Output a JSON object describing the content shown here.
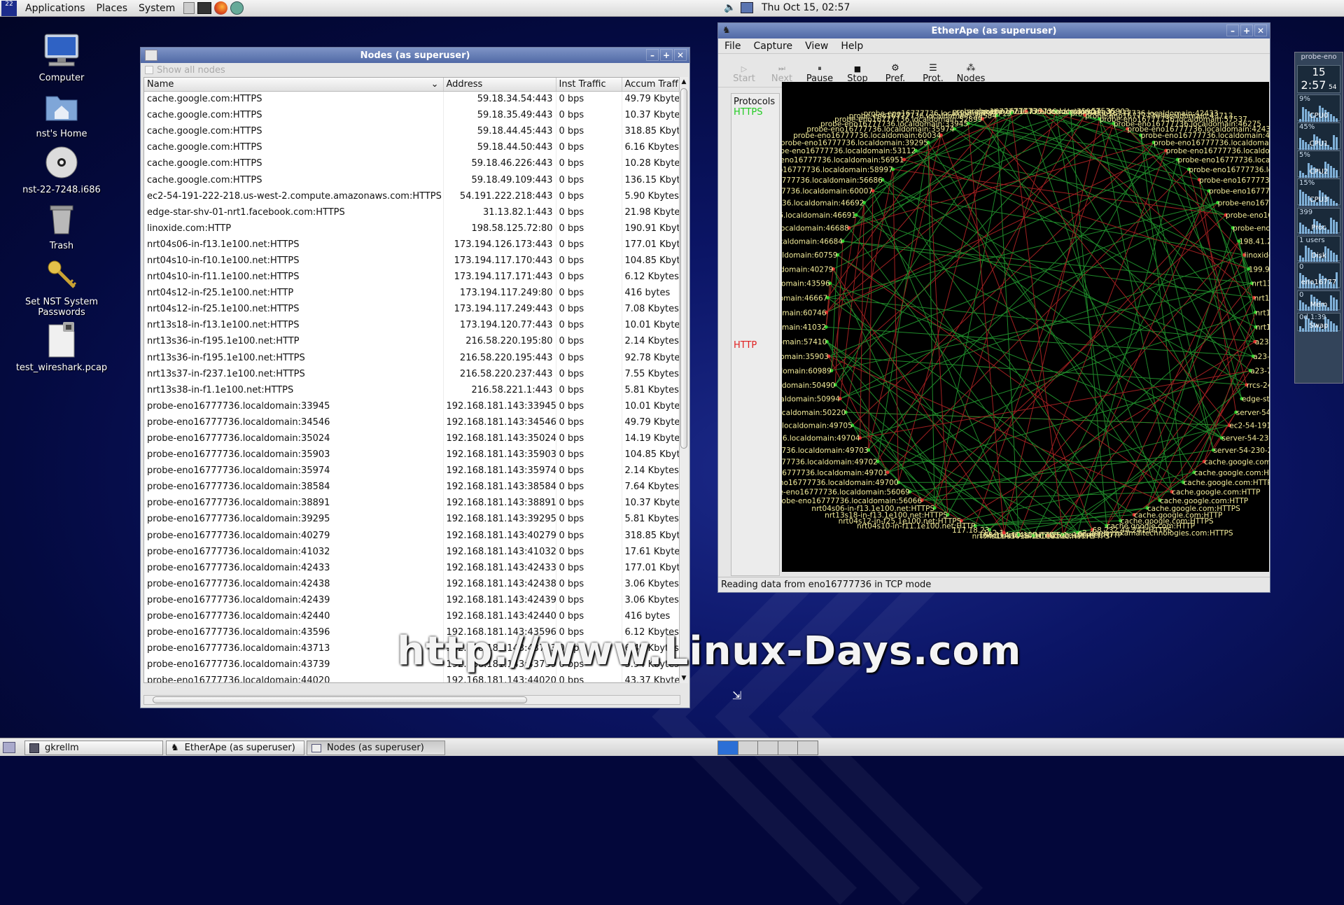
{
  "topbar": {
    "menu": [
      "Applications",
      "Places",
      "System"
    ],
    "clock": "Thu Oct 15, 02:57"
  },
  "desktop_icons": [
    {
      "label": "Computer",
      "icon": "computer-icon"
    },
    {
      "label": "nst's Home",
      "icon": "home-folder-icon"
    },
    {
      "label": "nst-22-7248.i686",
      "icon": "cd-icon"
    },
    {
      "label": "Trash",
      "icon": "trash-icon"
    },
    {
      "label": "Set NST System Passwords",
      "icon": "keys-icon"
    },
    {
      "label": "test_wireshark.pcap",
      "icon": "file-icon"
    }
  ],
  "nodes_window": {
    "title": "Nodes (as superuser)",
    "show_all": "Show all nodes",
    "columns": [
      "Name",
      "Address",
      "Inst Traffic",
      "Accum Traff"
    ],
    "rows": [
      [
        "cache.google.com:HTTPS",
        "59.18.34.54:443",
        "0 bps",
        "49.79 Kbyte"
      ],
      [
        "cache.google.com:HTTPS",
        "59.18.35.49:443",
        "0 bps",
        "10.37 Kbyte"
      ],
      [
        "cache.google.com:HTTPS",
        "59.18.44.45:443",
        "0 bps",
        "318.85 Kbyt"
      ],
      [
        "cache.google.com:HTTPS",
        "59.18.44.50:443",
        "0 bps",
        "6.16 Kbytes"
      ],
      [
        "cache.google.com:HTTPS",
        "59.18.46.226:443",
        "0 bps",
        "10.28 Kbyte"
      ],
      [
        "cache.google.com:HTTPS",
        "59.18.49.109:443",
        "0 bps",
        "136.15 Kbyt"
      ],
      [
        "ec2-54-191-222-218.us-west-2.compute.amazonaws.com:HTTPS",
        "54.191.222.218:443",
        "0 bps",
        "5.90 Kbytes"
      ],
      [
        "edge-star-shv-01-nrt1.facebook.com:HTTPS",
        "31.13.82.1:443",
        "0 bps",
        "21.98 Kbyte"
      ],
      [
        "linoxide.com:HTTP",
        "198.58.125.72:80",
        "0 bps",
        "190.91 Kbyt"
      ],
      [
        "nrt04s06-in-f13.1e100.net:HTTPS",
        "173.194.126.173:443",
        "0 bps",
        "177.01 Kbyt"
      ],
      [
        "nrt04s10-in-f10.1e100.net:HTTPS",
        "173.194.117.170:443",
        "0 bps",
        "104.85 Kbyt"
      ],
      [
        "nrt04s10-in-f11.1e100.net:HTTPS",
        "173.194.117.171:443",
        "0 bps",
        "6.12 Kbytes"
      ],
      [
        "nrt04s12-in-f25.1e100.net:HTTP",
        "173.194.117.249:80",
        "0 bps",
        "416 bytes"
      ],
      [
        "nrt04s12-in-f25.1e100.net:HTTPS",
        "173.194.117.249:443",
        "0 bps",
        "7.08 Kbytes"
      ],
      [
        "nrt13s18-in-f13.1e100.net:HTTPS",
        "173.194.120.77:443",
        "0 bps",
        "10.01 Kbyte"
      ],
      [
        "nrt13s36-in-f195.1e100.net:HTTP",
        "216.58.220.195:80",
        "0 bps",
        "2.14 Kbytes"
      ],
      [
        "nrt13s36-in-f195.1e100.net:HTTPS",
        "216.58.220.195:443",
        "0 bps",
        "92.78 Kbyte"
      ],
      [
        "nrt13s37-in-f237.1e100.net:HTTPS",
        "216.58.220.237:443",
        "0 bps",
        "7.55 Kbytes"
      ],
      [
        "nrt13s38-in-f1.1e100.net:HTTPS",
        "216.58.221.1:443",
        "0 bps",
        "5.81 Kbytes"
      ],
      [
        "probe-eno16777736.localdomain:33945",
        "192.168.181.143:33945",
        "0 bps",
        "10.01 Kbyte"
      ],
      [
        "probe-eno16777736.localdomain:34546",
        "192.168.181.143:34546",
        "0 bps",
        "49.79 Kbyte"
      ],
      [
        "probe-eno16777736.localdomain:35024",
        "192.168.181.143:35024",
        "0 bps",
        "14.19 Kbyte"
      ],
      [
        "probe-eno16777736.localdomain:35903",
        "192.168.181.143:35903",
        "0 bps",
        "104.85 Kbyt"
      ],
      [
        "probe-eno16777736.localdomain:35974",
        "192.168.181.143:35974",
        "0 bps",
        "2.14 Kbytes"
      ],
      [
        "probe-eno16777736.localdomain:38584",
        "192.168.181.143:38584",
        "0 bps",
        "7.64 Kbytes"
      ],
      [
        "probe-eno16777736.localdomain:38891",
        "192.168.181.143:38891",
        "0 bps",
        "10.37 Kbyte"
      ],
      [
        "probe-eno16777736.localdomain:39295",
        "192.168.181.143:39295",
        "0 bps",
        "5.81 Kbytes"
      ],
      [
        "probe-eno16777736.localdomain:40279",
        "192.168.181.143:40279",
        "0 bps",
        "318.85 Kbyt"
      ],
      [
        "probe-eno16777736.localdomain:41032",
        "192.168.181.143:41032",
        "0 bps",
        "17.61 Kbyte"
      ],
      [
        "probe-eno16777736.localdomain:42433",
        "192.168.181.143:42433",
        "0 bps",
        "177.01 Kbyt"
      ],
      [
        "probe-eno16777736.localdomain:42438",
        "192.168.181.143:42438",
        "0 bps",
        "3.06 Kbytes"
      ],
      [
        "probe-eno16777736.localdomain:42439",
        "192.168.181.143:42439",
        "0 bps",
        "3.06 Kbytes"
      ],
      [
        "probe-eno16777736.localdomain:42440",
        "192.168.181.143:42440",
        "0 bps",
        "416 bytes"
      ],
      [
        "probe-eno16777736.localdomain:43596",
        "192.168.181.143:43596",
        "0 bps",
        "6.12 Kbytes"
      ],
      [
        "probe-eno16777736.localdomain:43713",
        "192.168.181.143:43713",
        "0 bps",
        "6.49 Kbytes"
      ],
      [
        "probe-eno16777736.localdomain:43739",
        "192.168.181.143:43739",
        "0 bps",
        "5.94 Kbytes"
      ],
      [
        "probe-eno16777736.localdomain:44020",
        "192.168.181.143:44020",
        "0 bps",
        "43.37 Kbyte"
      ]
    ]
  },
  "etherape": {
    "title": "EtherApe (as superuser)",
    "menu": [
      "File",
      "Capture",
      "View",
      "Help"
    ],
    "toolbar": [
      "Start",
      "Next",
      "Pause",
      "Stop",
      "Pref.",
      "Prot.",
      "Nodes"
    ],
    "protocols_label": "Protocols",
    "protocols": [
      {
        "name": "HTTPS",
        "color": "#22cc22"
      },
      {
        "name": "HTTP",
        "color": "#e02020"
      }
    ],
    "status": "Reading data from eno16777736 in TCP mode",
    "graph_nodes": [
      "probe-eno16777736.localdomain:57536",
      "probe-eno16777736.localdomain:35903",
      "probe-eno16777736.localdomain:42433",
      "probe-eno16777736.localdomain:43713",
      "probe-eno16777736.localdomain:57537",
      "probe-eno16777736.localdomain:46275",
      "probe-eno16777736.localdomain:42438",
      "probe-eno16777736.localdomain:42439",
      "probe-eno16777736.localdomain:42440",
      "probe-eno16777736.localdomain:35024",
      "probe-eno16777736.localdomain:43739",
      "probe-eno16777736.localdomain:56803",
      "probe-eno16777736.localdomain:38891",
      "probe-eno16777736.localdomain:45807",
      "probe-eno16777736.localdomain:34546",
      "probe-eno16777736.localdomain:59378",
      "probe-eno16777736.localdomain:44020",
      "198.41.216.6:HTTPS",
      "linoxide.com:HTTP",
      "199.96.57.6:HTTPS",
      "nrt13s36-in-f195.1e100.net:HTTPS",
      "nrt13s36-in-f195.1e100.net:HTTP",
      "nrt13s37-in-f237.1e100.net:HTTPS",
      "nrt13s38-in-f1.1e100.net:HTTPS",
      "a23-12-231-136.deploy.static.akamaitechnol",
      "a23-33-157-244.deploy.static.akamaitechnol",
      "a23-76-153-42.deploy.static.akamaitechnol",
      "rrcs-24-97-150-195.nys.biz.rr.com",
      "edge-star-shv-01-nrt1.facebook.com",
      "server-54-182-152-213.icn51.r.cloudfront.n",
      "ec2-54-191-222-218.us-west-2.compute.amazonaw",
      "server-54-230-248-13.icn51.r.cloudfront.net",
      "server-54-230-248-17.icn51.r.cloudfront.net",
      "cache.google.com:HTTPS",
      "cache.google.com:HTTPS",
      "cache.google.com:HTTPS",
      "cache.google.com:HTTP",
      "cache.google.com:HTTP",
      "cache.google.com:HTTPS",
      "cache.google.com:HTTP",
      "cache.google.com:HTTPS",
      "cache.google.com:HTTP",
      "68.232.44.241:HTTPS",
      "e2.deploy.akamaitechnologies.com:HTTPS",
      "nrt04s12-in-f25.1e100.net:HTTP",
      "nrt04s10-in-f10.1e100.net:HTTPS",
      "nrt04s11-in-f15.1e100.net:HTTPS",
      "108.174.10.10:HTTPS",
      "112.1",
      "117.18.23",
      "nrt04s10-in-f11.1e100.net:HTTP",
      "nrt04s12-in-f25.1e100.net:HTTPS",
      "nrt13s18-in-f13.1e100.net:HTTPS",
      "nrt04s06-in-f13.1e100.net:HTTPS",
      "probe-eno16777736.localdomain:56066",
      "probe-eno16777736.localdomain:56069",
      "probe-eno16777736.localdomain:49700",
      "probe-eno16777736.localdomain:49701",
      "probe-eno16777736.localdomain:49702",
      "probe-eno16777736.localdomain:49703",
      "probe-eno16777736.localdomain:49704",
      "probe-eno16777736.localdomain:49705",
      "probe-eno16777736.localdomain:50220",
      "probe-eno16777736.localdomain:50994",
      "probe-eno16777736.localdomain:50490",
      "probe-eno16777736.localdomain:60989",
      "probe-eno16777736.localdomain:35903",
      "probe-eno16777736.localdomain:57410",
      "probe-eno16777736.localdomain:41032",
      "probe-eno16777736.localdomain:60746",
      "probe-eno16777736.localdomain:46667",
      "probe-eno16777736.localdomain:43596",
      "probe-eno16777736.localdomain:40279",
      "probe-eno16777736.localdomain:60759",
      "probe-eno16777736.localdomain:46684",
      "probe-eno16777736.localdomain:46688",
      "probe-eno16777736.localdomain:46691",
      "probe-eno16777736.localdomain:46692",
      "probe-eno16777736.localdomain:60007",
      "probe-eno16777736.localdomain:56686",
      "probe-eno16777736.localdomain:58997",
      "probe-eno16777736.localdomain:56951",
      "probe-eno16777736.localdomain:53112",
      "probe-eno16777736.localdomain:39295",
      "probe-eno16777736.localdomain:60034",
      "probe-eno16777736.localdomain:35974",
      "probe-eno16777736.localdomain:33945",
      "probe-eno16777736.localdomain:52899",
      "probe-eno16777736.localdomain:38584",
      "probe-eno16777736.localdomain:43713",
      "probe-eno16777736.localdomain:35903"
    ]
  },
  "gkrellm": {
    "host": "probe-eno",
    "time": "15",
    "clock": "2:57",
    "ampm": "54",
    "labels": [
      "CPU0",
      "CPU1",
      "CPU2",
      "CPU3",
      "Proc",
      "Disk",
      "eno16777",
      "Mem",
      "Swap"
    ],
    "values": [
      "9%",
      "45%",
      "5%",
      "15%",
      "399",
      "1 users",
      "0",
      "0",
      "0d 1:39"
    ]
  },
  "taskbar": {
    "items": [
      "gkrellm",
      "EtherApe (as superuser)",
      "Nodes (as superuser)"
    ]
  },
  "watermark": "http://www.Linux-Days.com"
}
